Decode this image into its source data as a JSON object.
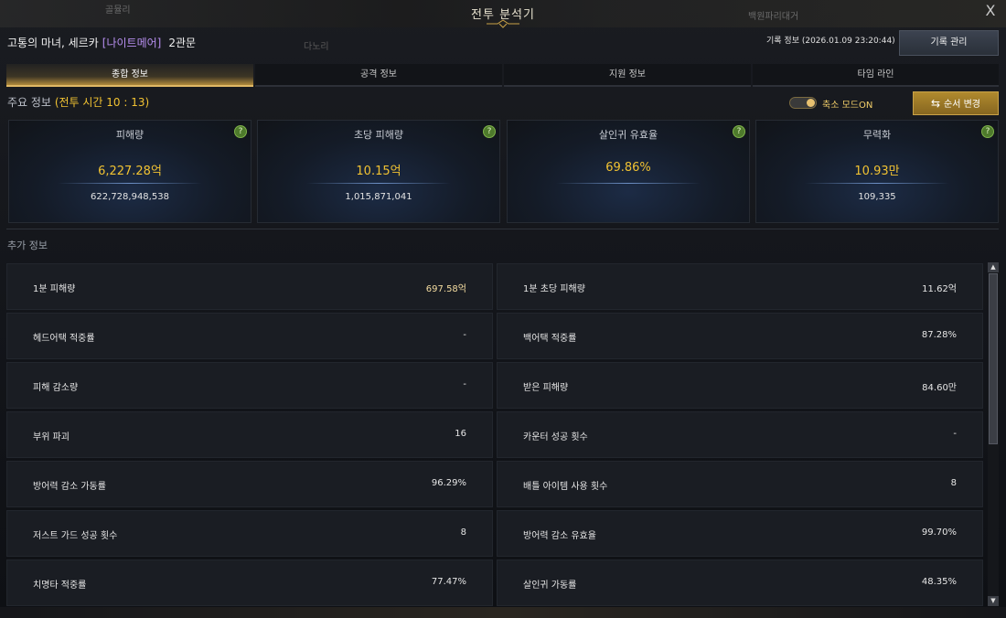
{
  "background": {
    "text1": "골뮬리",
    "text2": "백원파리대거",
    "text3": "다노리"
  },
  "window": {
    "title": "전투 분석기",
    "close_label": "X"
  },
  "header": {
    "boss_name": "고통의 마녀, 세르카",
    "difficulty": "[나이트메어]",
    "gate": "2관문",
    "record_time": "기록 정보 (2026.01.09 23:20:44)",
    "record_button": "기록 관리"
  },
  "tabs": [
    {
      "label": "종합 정보",
      "active": true
    },
    {
      "label": "공격 정보",
      "active": false
    },
    {
      "label": "지원 정보",
      "active": false
    },
    {
      "label": "타임 라인",
      "active": false
    }
  ],
  "main": {
    "label": "주요 정보",
    "battle_time": "(전투 시간 10 : 13)",
    "toggle_label": "축소 모드ON",
    "order_button": "순서 변경",
    "order_icon": "⇆",
    "help_glyph": "?"
  },
  "cards": [
    {
      "title": "피해량",
      "value": "6,227.28억",
      "sub": "622,728,948,538"
    },
    {
      "title": "초당 피해량",
      "value": "10.15억",
      "sub": "1,015,871,041"
    },
    {
      "title": "살인귀 유효율",
      "value": "69.86%",
      "sub": ""
    },
    {
      "title": "무력화",
      "value": "10.93만",
      "sub": "109,335"
    }
  ],
  "extra": {
    "label": "추가 정보",
    "left": [
      {
        "name": "1분 피해량",
        "value": "697.58억",
        "highlight": true
      },
      {
        "name": "헤드어택 적중률",
        "value": "-",
        "highlight": false
      },
      {
        "name": "피해 감소량",
        "value": "-",
        "highlight": false
      },
      {
        "name": "부위 파괴",
        "value": "16",
        "highlight": false
      },
      {
        "name": "방어력 감소 가동률",
        "value": "96.29%",
        "highlight": false
      },
      {
        "name": "저스트 가드 성공 횟수",
        "value": "8",
        "highlight": false
      },
      {
        "name": "치명타 적중률",
        "value": "77.47%",
        "highlight": false
      }
    ],
    "right": [
      {
        "name": "1분 초당 피해량",
        "value": "11.62억",
        "highlight": false
      },
      {
        "name": "백어택 적중률",
        "value": "87.28%",
        "highlight": false
      },
      {
        "name": "받은 피해량",
        "value": "84.60만",
        "highlight": false
      },
      {
        "name": "카운터 성공 횟수",
        "value": "-",
        "highlight": false
      },
      {
        "name": "배틀 아이템 사용 횟수",
        "value": "8",
        "highlight": false
      },
      {
        "name": "방어력 감소 유효율",
        "value": "99.70%",
        "highlight": false
      },
      {
        "name": "살인귀 가동률",
        "value": "48.35%",
        "highlight": false
      }
    ]
  },
  "scrollbar": {
    "up_glyph": "▲",
    "down_glyph": "▼"
  }
}
